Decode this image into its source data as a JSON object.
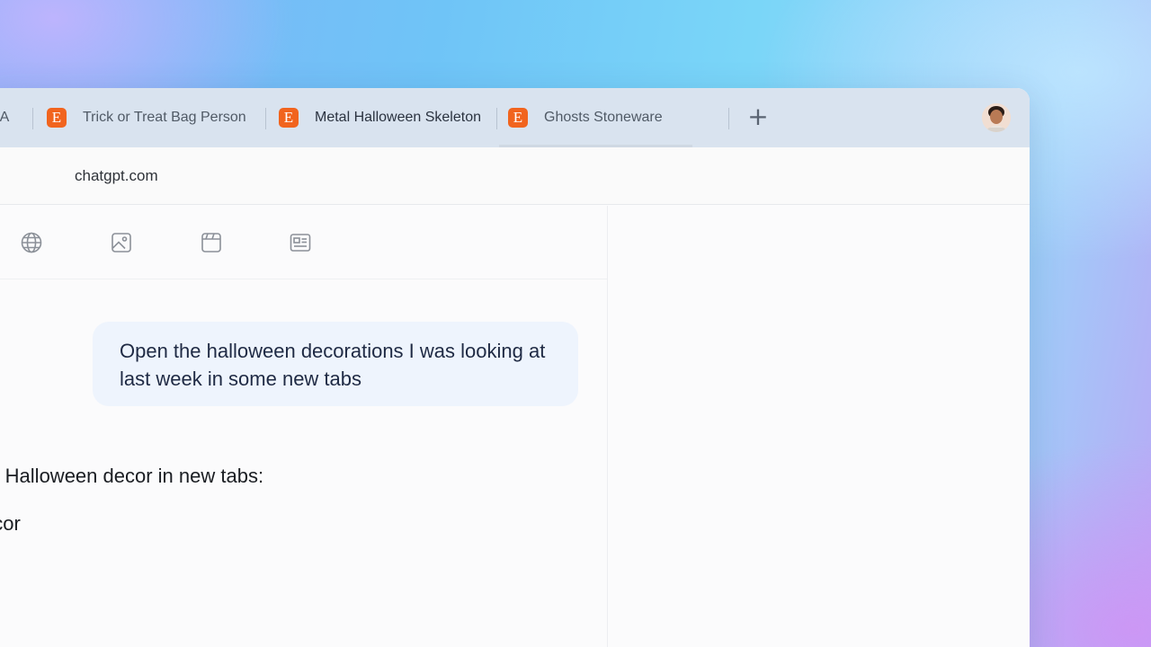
{
  "browser": {
    "tabs": [
      {
        "label": "all A",
        "has_favicon": false
      },
      {
        "label": "Trick or Treat Bag Person",
        "favicon": "E",
        "favicon_color": "#f1641e"
      },
      {
        "label": "Metal Halloween Skeleton",
        "favicon": "E",
        "favicon_color": "#f1641e"
      },
      {
        "label": "Ghosts Stoneware",
        "favicon": "E",
        "favicon_color": "#f1641e"
      }
    ],
    "new_tab_label": "+",
    "address": "chatgpt.com"
  },
  "toolbar_icons": [
    "globe-icon",
    "image-icon",
    "video-icon",
    "news-icon"
  ],
  "chat": {
    "user_message": "Open the halloween decorations I was looking at last week in some new tabs",
    "assistant_line1": "or Halloween decor in new tabs:",
    "assistant_line2": "ecor"
  }
}
